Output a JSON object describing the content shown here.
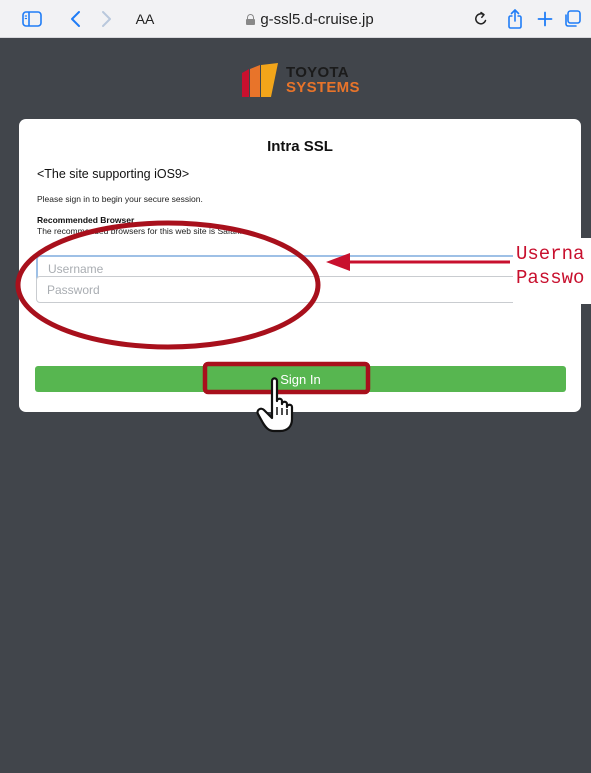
{
  "browser": {
    "reader_label": "AA",
    "url": "g-ssl5.d-cruise.jp"
  },
  "logo": {
    "line1": "TOYOTA",
    "line2": "SYSTEMS"
  },
  "login": {
    "title": "Intra SSL",
    "support_note": "<The site supporting iOS9>",
    "signin_message": "Please sign in to begin your secure session.",
    "recommended_heading": "Recommended Browser",
    "recommended_text": "The recommended browsers for this web site is Safari.",
    "username_placeholder": "Username",
    "password_placeholder": "Password",
    "signin_label": "Sign In"
  },
  "annotation": {
    "line1": "Userna",
    "line2": "Passwo"
  },
  "colors": {
    "background": "#41454b",
    "signin_button": "#57b650",
    "annotation_red": "#c8102e",
    "logo_orange": "#e8742a",
    "browser_blue": "#1f7cf6"
  },
  "icons": {
    "sidebar": "sidebar-icon",
    "back": "chevron-left-icon",
    "forward": "chevron-right-icon",
    "lock": "lock-icon",
    "reload": "reload-icon",
    "share": "share-icon",
    "new_tab": "plus-icon",
    "tabs": "tabs-icon",
    "cursor": "hand-pointer-icon"
  }
}
